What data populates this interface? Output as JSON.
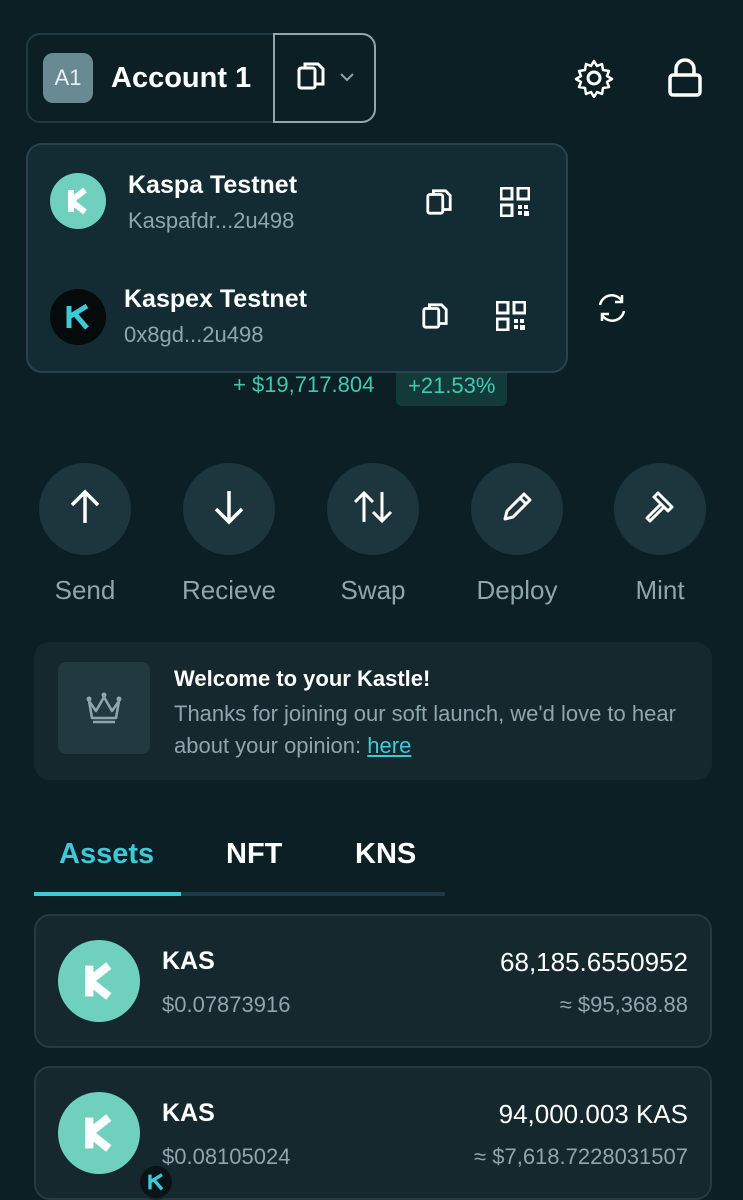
{
  "header": {
    "avatar_text": "A1",
    "account_name": "Account 1",
    "icons": [
      "copy-icon",
      "chevron-down-icon",
      "gear-icon",
      "lock-icon"
    ]
  },
  "networks": [
    {
      "name": "Kaspa Testnet",
      "address": "Kaspafdr...2u498",
      "logo": "kaspa-logo-icon"
    },
    {
      "name": "Kaspex Testnet",
      "address": "0x8gd...2u498",
      "logo": "kaspex-logo-icon"
    }
  ],
  "balance": {
    "change_amount": "+ $19,717.804",
    "change_percent": "+21.53%"
  },
  "actions": [
    {
      "label": "Send",
      "icon": "arrow-up-icon"
    },
    {
      "label": "Recieve",
      "icon": "arrow-down-icon"
    },
    {
      "label": "Swap",
      "icon": "swap-icon"
    },
    {
      "label": "Deploy",
      "icon": "pencil-icon"
    },
    {
      "label": "Mint",
      "icon": "hammer-icon"
    }
  ],
  "welcome": {
    "title": "Welcome to your Kastle!",
    "text": "Thanks for joining our soft launch, we'd love to hear about your opinion: ",
    "link": "here",
    "icon": "crown-icon"
  },
  "tabs": [
    "Assets",
    "NFT",
    "KNS"
  ],
  "assets": [
    {
      "symbol": "KAS",
      "price": "$0.07873916",
      "amount": "68,185.6550952",
      "value": "≈ $95,368.88"
    },
    {
      "symbol": "KAS",
      "price": "$0.08105024",
      "amount": "94,000.003 KAS",
      "value": "≈ $7,618.7228031507"
    }
  ],
  "colors": {
    "background": "#0b1f25",
    "accent": "#3ec9d8",
    "positive": "#3ec9b0",
    "muted_text": "#8fa6ad",
    "card": "#14282e"
  }
}
